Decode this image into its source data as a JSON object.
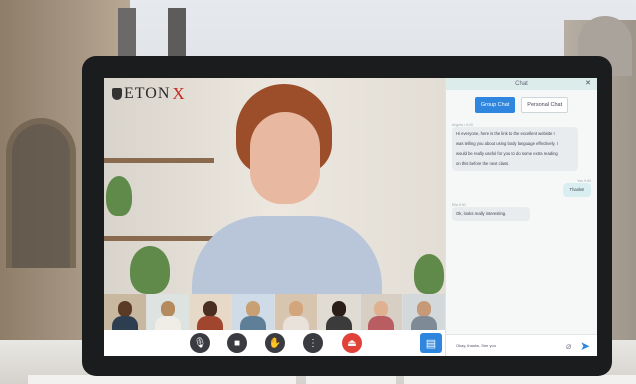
{
  "logo": {
    "brand": "ETON",
    "mark": "X"
  },
  "chat": {
    "title": "Chat",
    "close": "✕",
    "tabs": [
      {
        "label": "Group Chat",
        "active": true
      },
      {
        "label": "Personal Chat",
        "active": false
      }
    ],
    "messages": [
      {
        "meta": "Angela • 9:00",
        "lines": [
          "Hi everyone, here is the link to the excellent website I",
          "was telling you about using body language effectively. I",
          "would be really useful for you to do some extra reading",
          "on this before the next class."
        ],
        "side": "left"
      },
      {
        "meta": "You 9:00",
        "lines": [
          "Thanks!"
        ],
        "side": "right"
      },
      {
        "meta": "Ella 9:00",
        "lines": [
          "Ok, looks really interesting."
        ],
        "side": "left"
      }
    ],
    "input_text": "Okay, thanks. See you"
  },
  "controls": [
    {
      "name": "mic",
      "glyph": "🎙"
    },
    {
      "name": "camera",
      "glyph": "■"
    },
    {
      "name": "raise-hand",
      "glyph": "✋"
    },
    {
      "name": "more",
      "glyph": "⋮"
    },
    {
      "name": "leave",
      "glyph": "⏏"
    }
  ],
  "colors": {
    "accent": "#2e86de",
    "end_call": "#e0423a",
    "logo_x": "#c8281f"
  }
}
